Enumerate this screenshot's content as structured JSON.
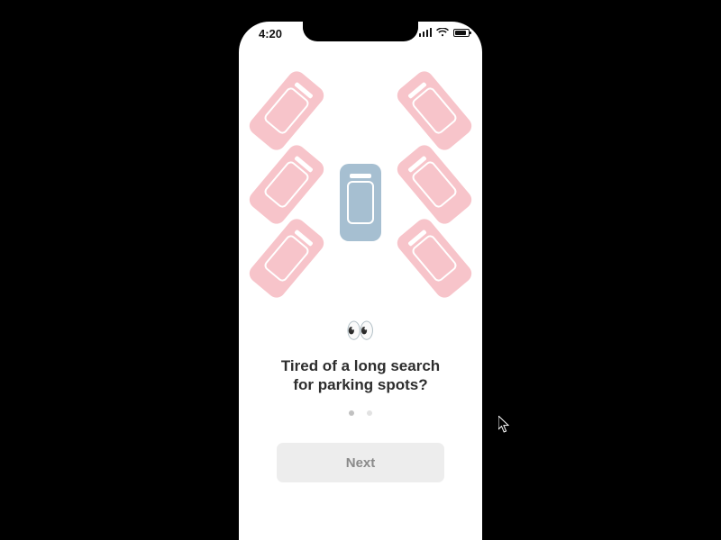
{
  "status": {
    "time": "4:20"
  },
  "onboarding": {
    "emoji": "👀",
    "headline_line1": "Tired of a long search",
    "headline_line2": "for parking spots?",
    "next_label": "Next",
    "page_index": 0,
    "page_count": 2
  },
  "colors": {
    "pink": "#f7c4ca",
    "blue": "#a6bfd1",
    "button_bg": "#ededed",
    "button_fg": "#8a8a8a"
  }
}
